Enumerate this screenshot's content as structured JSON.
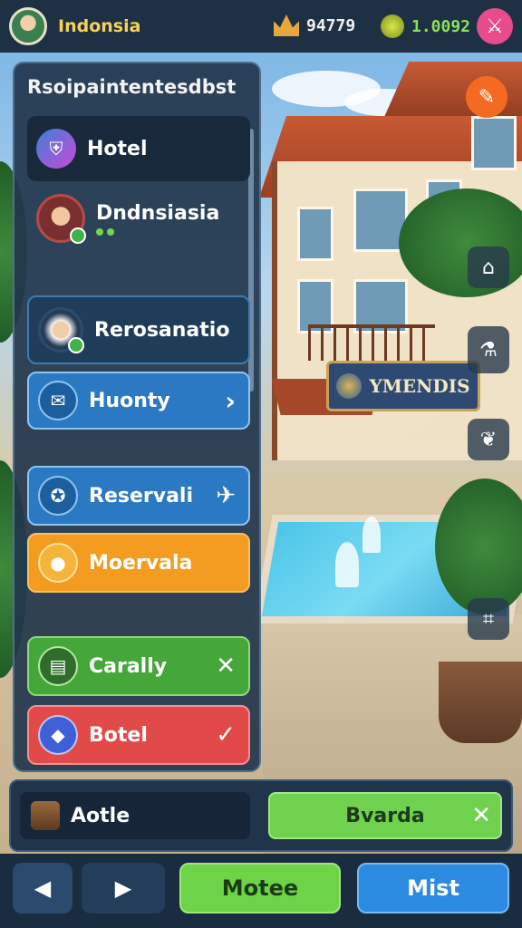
{
  "topbar": {
    "region": "Indonsia",
    "crown_value": "94779",
    "coin_value": "1.0092",
    "menu_icon": "sword-icon"
  },
  "panel": {
    "title": "Rsoipaintentesdbst",
    "items": [
      {
        "label": "Hotel",
        "icon": "shield-icon"
      },
      {
        "label": "Dndnsiasia",
        "icon": "portrait"
      },
      {
        "label": "Rerosanatio",
        "icon": "chef-portrait"
      },
      {
        "label": "Huonty",
        "icon": "chat-icon",
        "trail": "›"
      },
      {
        "label": "Reservali",
        "icon": "compass-icon",
        "trail": "✈"
      },
      {
        "label": "Moervala",
        "icon": "coin-icon",
        "trail": ""
      },
      {
        "label": "Carally",
        "icon": "book-icon",
        "trail": "✕"
      },
      {
        "label": "Botel",
        "icon": "gem-icon",
        "trail": "✓"
      }
    ]
  },
  "scene": {
    "sign_text": "YMENDIS"
  },
  "bottom": {
    "left_label": "Aotle",
    "right_label": "Bvarda",
    "nav_back": "◀",
    "nav_fwd": "▶",
    "nav_primary": "Motee",
    "nav_secondary": "Mist"
  },
  "colors": {
    "accent_green": "#6fd14d",
    "accent_blue": "#2a79c2",
    "accent_orange": "#f39c1f",
    "accent_red": "#e24a4a"
  }
}
